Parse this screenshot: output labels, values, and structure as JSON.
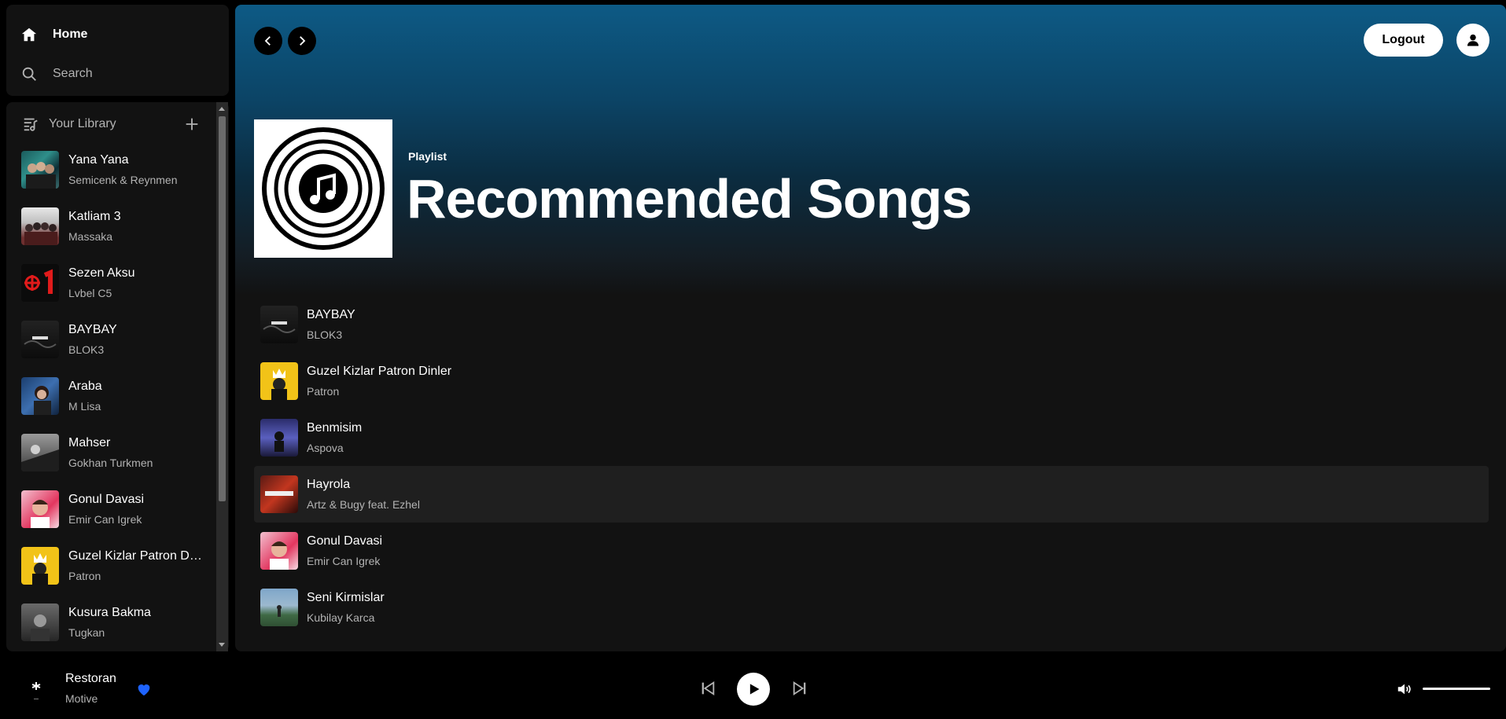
{
  "nav": {
    "home_label": "Home",
    "search_label": "Search"
  },
  "library": {
    "title": "Your Library",
    "items": [
      {
        "title": "Yana Yana",
        "artist": "Semicenk & Reynmen"
      },
      {
        "title": "Katliam 3",
        "artist": "Massaka"
      },
      {
        "title": "Sezen Aksu",
        "artist": "Lvbel C5"
      },
      {
        "title": "BAYBAY",
        "artist": "BLOK3"
      },
      {
        "title": "Araba",
        "artist": "M Lisa"
      },
      {
        "title": "Mahser",
        "artist": "Gokhan Turkmen"
      },
      {
        "title": "Gonul Davasi",
        "artist": "Emir Can Igrek"
      },
      {
        "title": "Guzel Kizlar Patron Dinler",
        "artist": "Patron"
      },
      {
        "title": "Kusura Bakma",
        "artist": "Tugkan"
      }
    ]
  },
  "header": {
    "logout_label": "Logout"
  },
  "playlist": {
    "type": "Playlist",
    "title": "Recommended Songs",
    "songs": [
      {
        "title": "BAYBAY",
        "artist": "BLOK3"
      },
      {
        "title": "Guzel Kizlar Patron Dinler",
        "artist": "Patron"
      },
      {
        "title": "Benmisim",
        "artist": "Aspova"
      },
      {
        "title": "Hayrola",
        "artist": "Artz & Bugy feat. Ezhel"
      },
      {
        "title": "Gonul Davasi",
        "artist": "Emir Can Igrek"
      },
      {
        "title": "Seni Kirmislar",
        "artist": "Kubilay Karca"
      }
    ]
  },
  "player": {
    "title": "Restoran",
    "artist": "Motive",
    "liked": true,
    "volume": 1.0
  },
  "colors": {
    "accent": "#1e63ff",
    "bg": "#121212",
    "header_gradient_top": "#0d5a85"
  }
}
